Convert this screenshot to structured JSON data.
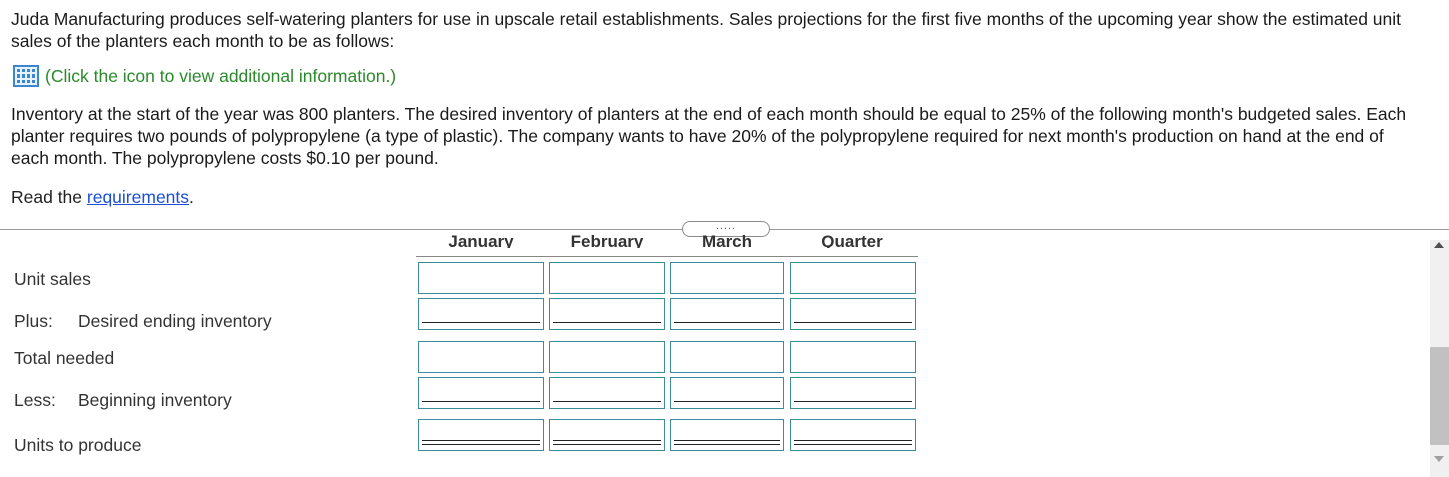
{
  "intro_text": "Juda Manufacturing produces self-watering planters for use in upscale retail establishments. Sales projections for the first five months of the upcoming year show the estimated unit sales of the planters each month to be as follows:",
  "info_link": "(Click the icon to view additional information.)",
  "body_text": "Inventory at the start of the year was 800 planters. The desired inventory of planters at the end of each month should be equal to 25% of the following month's budgeted sales. Each planter requires two pounds of polypropylene (a type of plastic). The company wants to have 20% of the polypropylene required for next month's production on hand at the end of each month. The polypropylene costs $0.10 per pound.",
  "requirements": {
    "prefix": "Read the ",
    "link": "requirements",
    "suffix": "."
  },
  "expand_handle": ".....",
  "table": {
    "columns": [
      "January",
      "February",
      "March",
      "Quarter"
    ],
    "rows": [
      {
        "prefix": "",
        "label": "Unit sales",
        "underline": "none"
      },
      {
        "prefix": "Plus:",
        "label": "Desired ending inventory",
        "underline": "single"
      },
      {
        "prefix": "",
        "label": "Total needed",
        "underline": "none"
      },
      {
        "prefix": "Less:",
        "label": "Beginning inventory",
        "underline": "single"
      },
      {
        "prefix": "",
        "label": "Units to produce",
        "underline": "double"
      }
    ]
  },
  "colors": {
    "link": "#1a4fd6",
    "info_text": "#2a8a2a",
    "cell_border": "#3a8c9a",
    "icon": "#3a86d1"
  }
}
